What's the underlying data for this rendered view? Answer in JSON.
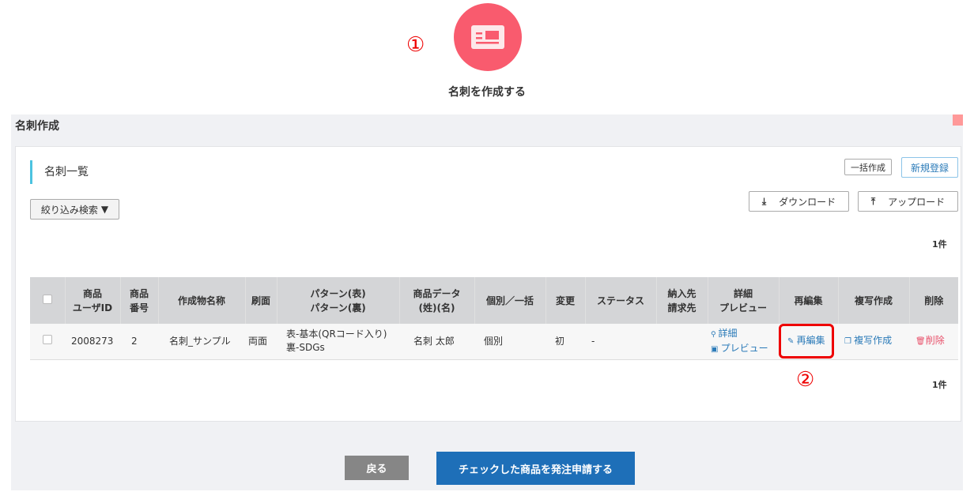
{
  "annotations": {
    "step1": "①",
    "step2": "②"
  },
  "hero": {
    "icon": "business-card-icon",
    "title": "名刺を作成する",
    "color": "#f95b6e"
  },
  "panel": {
    "title": "名刺作成"
  },
  "section": {
    "title": "名刺一覧"
  },
  "toolbar": {
    "filter": "絞り込み検索",
    "bulk": "一括作成",
    "new": "新規登録",
    "download": "ダウンロード",
    "upload": "アップロード"
  },
  "count_top": "1件",
  "count_bottom": "1件",
  "table": {
    "headers": [
      "商品\nユーザID",
      "商品\n番号",
      "作成物名称",
      "刷面",
      "パターン(表)\nパターン(裏)",
      "商品データ\n(姓)(名)",
      "個別／一括",
      "変更",
      "ステータス",
      "納入先\n請求先",
      "詳細\nプレビュー",
      "再編集",
      "複写作成",
      "削除"
    ],
    "rows": [
      {
        "user_id": "2008273",
        "number": "2",
        "name": "名刺_サンプル",
        "side": "両面",
        "pattern_front": "表-基本(QRコード入り)",
        "pattern_back": "裏-SDGs",
        "data": "名刺 太郎",
        "type": "個別",
        "change": "初",
        "status": "-",
        "delivery": "",
        "detail": "詳細",
        "preview": "プレビュー",
        "reedit": "再編集",
        "copy": "複写作成",
        "delete": "削除"
      }
    ]
  },
  "footer": {
    "back": "戻る",
    "submit": "チェックした商品を発注申請する"
  }
}
